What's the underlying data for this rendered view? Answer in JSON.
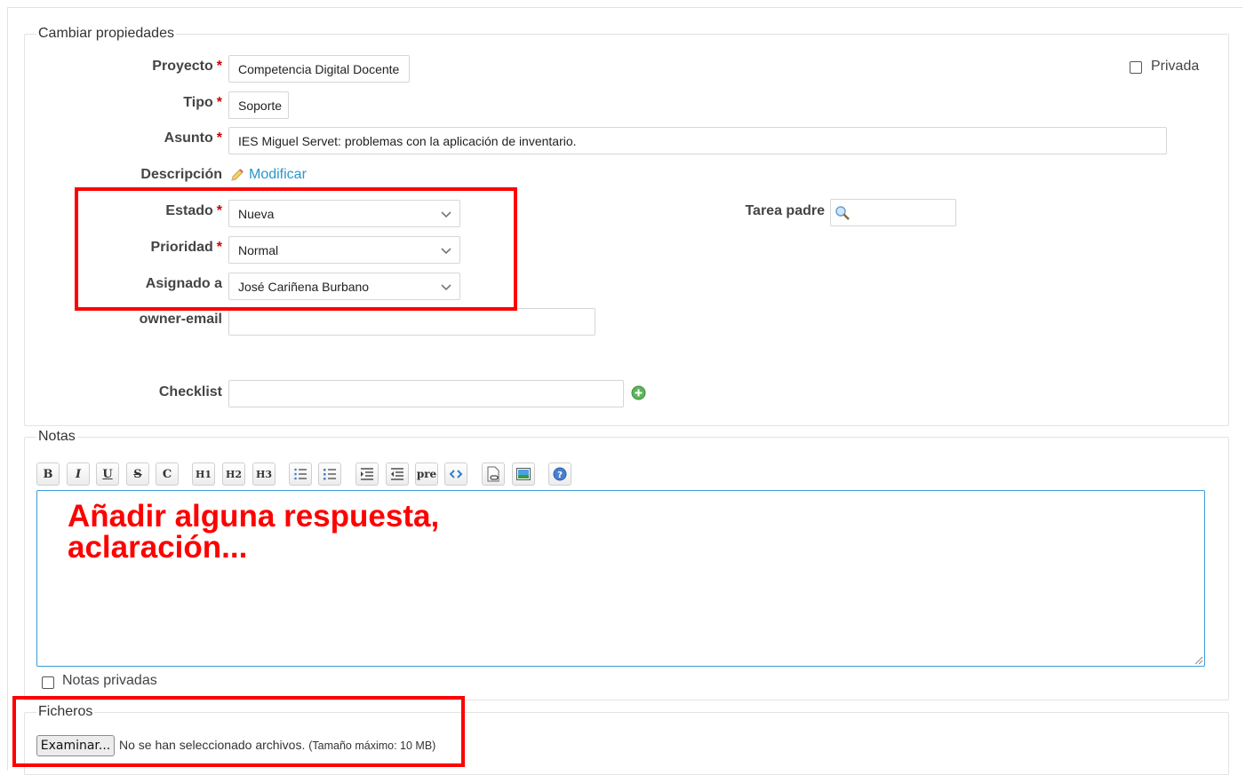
{
  "properties": {
    "legend": "Cambiar propiedades",
    "proyecto": {
      "label": "Proyecto",
      "value": "Competencia Digital Docente"
    },
    "tipo": {
      "label": "Tipo",
      "value": "Soporte"
    },
    "asunto": {
      "label": "Asunto",
      "value": "IES Miguel Servet: problemas con la aplicación de inventario."
    },
    "descripcion": {
      "label": "Descripción",
      "edit_link": "Modificar"
    },
    "estado": {
      "label": "Estado",
      "value": "Nueva"
    },
    "prioridad": {
      "label": "Prioridad",
      "value": "Normal"
    },
    "asignado": {
      "label": "Asignado a",
      "value": "José Cariñena Burbano"
    },
    "owner_email": {
      "label": "owner-email",
      "value": ""
    },
    "checklist": {
      "label": "Checklist",
      "value": ""
    },
    "tarea_padre": {
      "label": "Tarea padre",
      "value": ""
    },
    "privada": {
      "label": "Privada",
      "checked": false
    },
    "required_marker": "*"
  },
  "notes": {
    "legend": "Notas",
    "toolbar": {
      "bold": "B",
      "italic": "I",
      "underline": "U",
      "strike": "S",
      "code": "C",
      "h1": "H1",
      "h2": "H2",
      "h3": "H3",
      "pre": "pre"
    },
    "annotation": "Añadir alguna respuesta,\naclaración...",
    "private_label": "Notas privadas",
    "private_checked": false
  },
  "files": {
    "legend": "Ficheros",
    "browse_button": "Examinar...",
    "no_file_text": "No se han seleccionado archivos.",
    "max_size": "(Tamaño máximo: 10 MB)"
  },
  "colors": {
    "highlight": "#ff0000",
    "link": "#2996cc",
    "required": "#cc0000",
    "focus_border": "#3c9bd6"
  }
}
